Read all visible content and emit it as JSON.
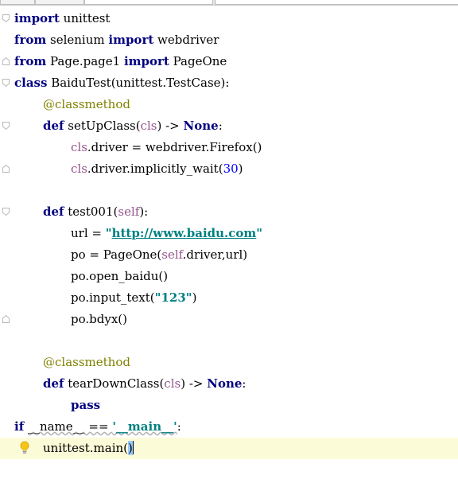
{
  "tabs": [
    "",
    "",
    "",
    ""
  ],
  "colors": {
    "keyword": "#000080",
    "decorator": "#808000",
    "self_param": "#94558d",
    "number": "#0000ff",
    "string": "#008080",
    "current_line": "#fbfbd8"
  },
  "code": {
    "l1": {
      "kw1": "import",
      "t1": " unittest"
    },
    "l2": {
      "kw1": "from",
      "t1": " selenium ",
      "kw2": "import",
      "t2": " webdriver"
    },
    "l3": {
      "kw1": "from",
      "t1": " Page.page1 ",
      "kw2": "import",
      "t2": " PageOne"
    },
    "l4": {
      "kw1": "class",
      "t1": " BaiduTest(unittest.TestCase):"
    },
    "l5": {
      "deco": "@classmethod"
    },
    "l6": {
      "kw1": "def",
      "t1": " setUpClass(",
      "p1": "cls",
      "t2": ") -> ",
      "kw2": "None",
      "t3": ":"
    },
    "l7": {
      "p1": "cls",
      "t1": ".driver = webdriver.Firefox()"
    },
    "l8": {
      "p1": "cls",
      "t1": ".driver.implicitly_wait(",
      "n1": "30",
      "t2": ")"
    },
    "l9": {
      "kw1": "def",
      "t1": " test001(",
      "p1": "self",
      "t2": "):"
    },
    "l10": {
      "t1": "url = ",
      "s1": "\"",
      "link": "http://www.baidu.com",
      "s2": "\""
    },
    "l11": {
      "t1": "po = PageOne(",
      "p1": "self",
      "t2": ".driver,url)"
    },
    "l12": {
      "t1": "po.open_baidu()"
    },
    "l13": {
      "t1": "po.input_text(",
      "s1": "\"123\"",
      "t2": ")"
    },
    "l14": {
      "t1": "po.bdyx()"
    },
    "l15": {
      "deco": "@classmethod"
    },
    "l16": {
      "kw1": "def",
      "t1": " tearDownClass(",
      "p1": "cls",
      "t2": ") -> ",
      "kw2": "None",
      "t3": ":"
    },
    "l17": {
      "kw1": "pass"
    },
    "l18": {
      "kw1": "if",
      "t1": " ",
      "m1": "__name__",
      "t2": " == ",
      "s1": "'__main__'",
      "t3": ":"
    },
    "l19": {
      "t1": "unittest.main(",
      "t2": ")"
    }
  },
  "icons": {
    "fold": "fold-marker-icon",
    "bulb": "lightbulb-icon"
  }
}
